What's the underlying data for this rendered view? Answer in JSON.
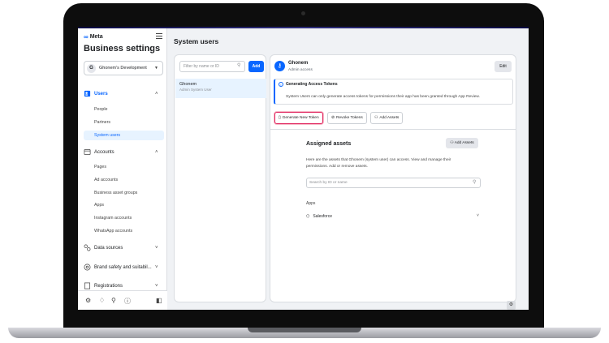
{
  "brand": {
    "logo": "Meta",
    "logo_mark": "∞"
  },
  "sidebar": {
    "title": "Business settings",
    "account": {
      "initial": "G",
      "name": "Ghonem's Development"
    },
    "sections": [
      {
        "label": "Users",
        "items": [
          "People",
          "Partners",
          "System users"
        ],
        "active": "System users"
      },
      {
        "label": "Accounts",
        "items": [
          "Pages",
          "Ad accounts",
          "Business asset groups",
          "Apps",
          "Instagram accounts",
          "WhatsApp accounts"
        ]
      },
      {
        "label": "Data sources"
      },
      {
        "label": "Brand safety and suitabil..."
      },
      {
        "label": "Registrations"
      }
    ]
  },
  "page": {
    "title": "System users"
  },
  "list": {
    "filter_placeholder": "Filter by name or ID",
    "add_label": "Add",
    "users": [
      {
        "name": "Ghonem",
        "role": "Admin System User"
      }
    ]
  },
  "detail": {
    "name": "Ghonem",
    "role": "Admin access",
    "edit_label": "Edit",
    "notice_title": "Generating Access Tokens",
    "notice_body": "System Users can only generate access tokens for permissions their app has been granted through App Review.",
    "buttons": {
      "generate": "Generate New Token",
      "revoke": "Revoke Tokens",
      "add_assets": "Add Assets"
    },
    "assigned": {
      "title": "Assigned assets",
      "add_label": "Add Assets",
      "description": "Here are the assets that Ghonem (system user) can access. View and manage their permissions. Add or remove assets.",
      "search_placeholder": "Search by ID or name",
      "apps_label": "Apps",
      "app_name": "Salesforce"
    }
  },
  "colors": {
    "brand_blue": "#0866ff",
    "highlight_red": "#e0245e",
    "active_bg": "#e7f3ff"
  },
  "icons": [
    "meta-logo-icon",
    "menu-icon",
    "users-icon",
    "accounts-icon",
    "data-sources-icon",
    "brand-safety-icon",
    "registrations-icon",
    "settings-icon",
    "notifications-icon",
    "search-icon",
    "help-icon",
    "sidebar-toggle-icon",
    "key-icon",
    "info-icon",
    "token-icon",
    "revoke-icon",
    "people-icon",
    "cube-icon",
    "chevron-down-icon"
  ]
}
